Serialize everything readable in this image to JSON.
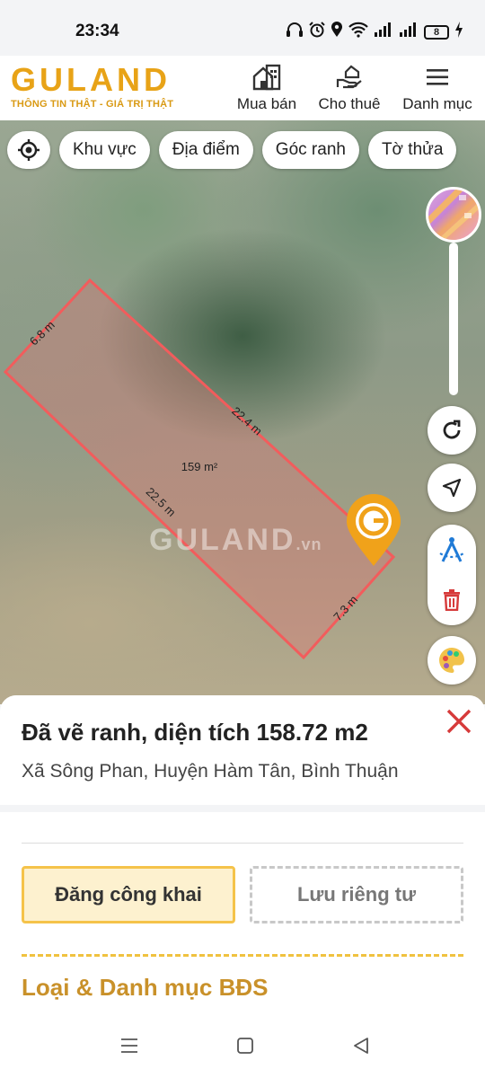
{
  "status_bar": {
    "time": "23:34",
    "battery": "8"
  },
  "header": {
    "logo_text": "GULAND",
    "tagline": "THÔNG TIN THẬT - GIÁ TRỊ THẬT",
    "nav": [
      {
        "label": "Mua bán",
        "icon": "building-icon"
      },
      {
        "label": "Cho thuê",
        "icon": "hand-house-icon"
      },
      {
        "label": "Danh mục",
        "icon": "menu-icon"
      }
    ]
  },
  "map": {
    "chips": [
      "Khu vực",
      "Địa điểm",
      "Góc ranh",
      "Tờ thửa"
    ],
    "plot_edges": {
      "top_left": "6.8 m",
      "top_right": "22.4 m",
      "bottom_left": "22.5 m",
      "bottom_right": "7.3 m"
    },
    "area_label": "159 m²",
    "watermark": "GULAND",
    "watermark_suffix": ".vn",
    "plot_color": "#f25c5c"
  },
  "sheet": {
    "title": "Đã vẽ ranh, diện tích 158.72 m2",
    "address": "Xã Sông Phan, Huyện Hàm Tân, Bình Thuận",
    "public_button": "Đăng công khai",
    "private_button": "Lưu riêng tư",
    "section_title": "Loại & Danh mục BĐS"
  },
  "colors": {
    "brand": "#e8a317",
    "accent_red": "#d63a3a",
    "section_gold": "#c9912a"
  }
}
